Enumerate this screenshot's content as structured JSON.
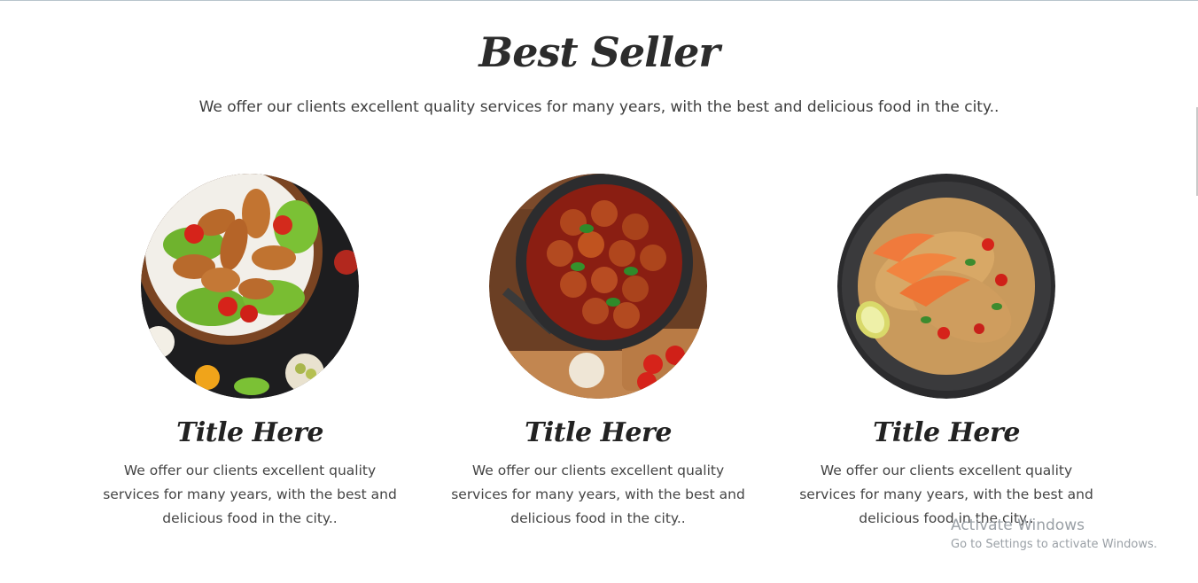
{
  "section": {
    "title": "Best Seller",
    "subtitle": "We offer our clients excellent quality services for many years, with the best and delicious food in the city.."
  },
  "cards": [
    {
      "image_icon": "fried-chicken-plate-image",
      "title": "Title Here",
      "text": "We offer our clients excellent quality services for many years, with the best and delicious food in the city.."
    },
    {
      "image_icon": "meatballs-pan-image",
      "title": "Title Here",
      "text": "We offer our clients excellent quality services for many years, with the best and delicious food in the city.."
    },
    {
      "image_icon": "shrimp-noodles-bowl-image",
      "title": "Title Here",
      "text": "We offer our clients excellent quality services for many years, with the best and delicious food in the city.."
    }
  ],
  "watermark": {
    "title": "Activate Windows",
    "subtitle": "Go to Settings to activate Windows."
  },
  "colors": {
    "heading": "#2c2c2c",
    "body_text": "#444444",
    "watermark": "#9aa0a6"
  }
}
